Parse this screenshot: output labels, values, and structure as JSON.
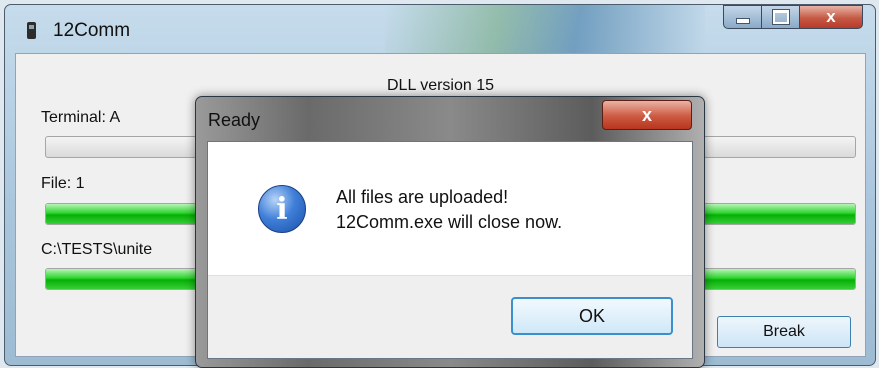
{
  "window": {
    "title": "12Comm",
    "icon": "terminal-icon",
    "controls": [
      "minimize-icon",
      "maximize-icon",
      "close-icon"
    ],
    "close_glyph": "x"
  },
  "main": {
    "dll_version": "DLL version 15",
    "terminal_label": "Terminal: A",
    "file_label": "File: 1",
    "path_label": "C:\\TESTS\\unite",
    "progress": {
      "terminal": 0,
      "file": 1,
      "path": 1
    },
    "break_label": "Break"
  },
  "dialog": {
    "title": "Ready",
    "close_glyph": "x",
    "icon": "info-icon",
    "icon_glyph": "i",
    "message_line1": "All files are uploaded!",
    "message_line2": "12Comm.exe will close now.",
    "ok_label": "OK"
  },
  "colors": {
    "progress_fill": "#06b006",
    "close_red": "#c55a44",
    "ok_border": "#3c8fcf"
  }
}
